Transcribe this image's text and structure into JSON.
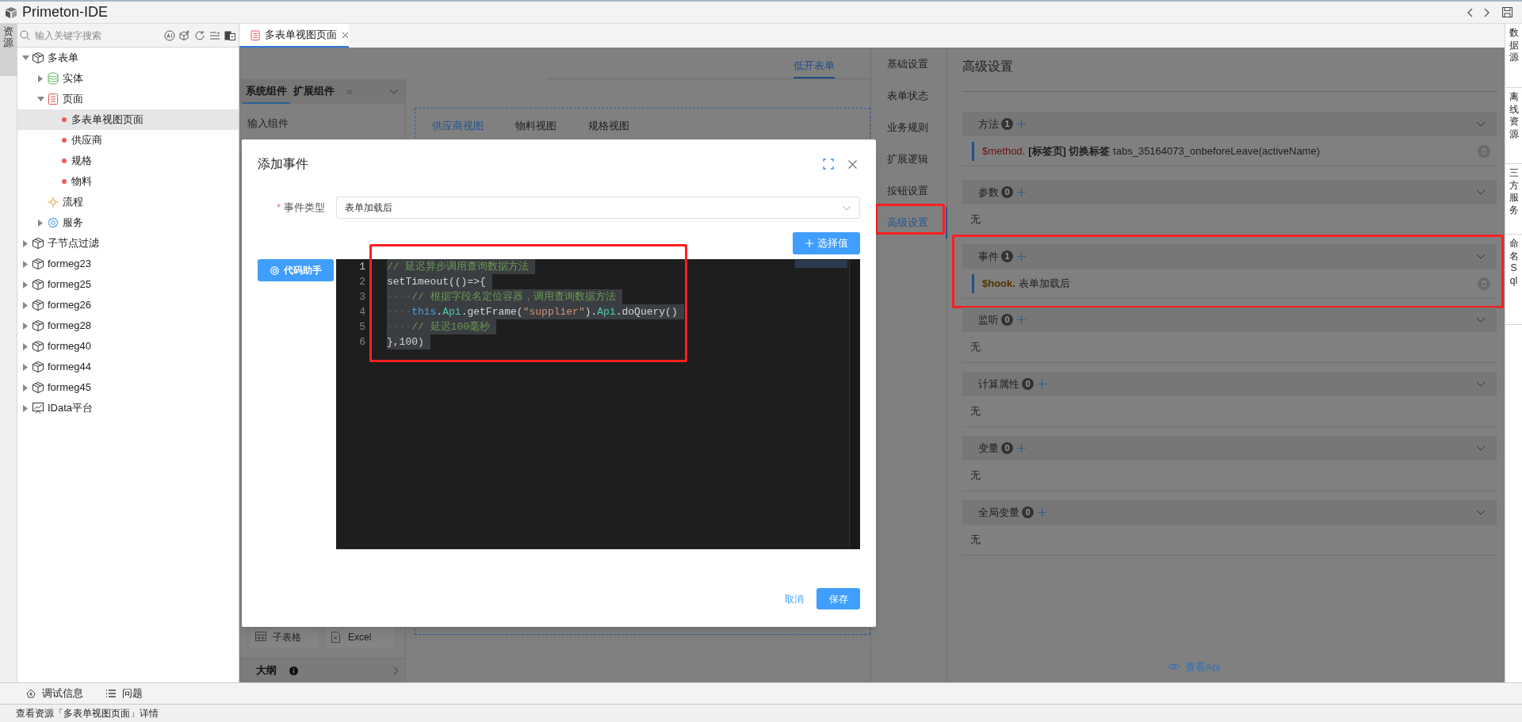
{
  "app": {
    "title": "Primeton-IDE"
  },
  "left_strip": [
    {
      "label": "资源",
      "selected": true
    }
  ],
  "sidebar": {
    "search": {
      "placeholder": "输入关键字搜索"
    },
    "tree": [
      {
        "label": "多表单",
        "kind": "module",
        "expanded": true,
        "selected": false,
        "children": [
          {
            "label": "实体",
            "kind": "entity",
            "expanded": false,
            "selected": false
          },
          {
            "label": "页面",
            "kind": "page",
            "expanded": true,
            "selected": false,
            "children": [
              {
                "label": "多表单视图页面",
                "kind": "view",
                "selected": true
              },
              {
                "label": "供应商",
                "kind": "view",
                "selected": false
              },
              {
                "label": "规格",
                "kind": "view",
                "selected": false
              },
              {
                "label": "物料",
                "kind": "view",
                "selected": false
              }
            ]
          },
          {
            "label": "流程",
            "kind": "flow",
            "selected": false
          },
          {
            "label": "服务",
            "kind": "service",
            "expanded": false,
            "selected": false
          }
        ]
      },
      {
        "label": "子节点过滤",
        "kind": "module",
        "expanded": false,
        "selected": false
      },
      {
        "label": "formeg23",
        "kind": "module",
        "expanded": false,
        "selected": false
      },
      {
        "label": "formeg25",
        "kind": "module",
        "expanded": false,
        "selected": false
      },
      {
        "label": "formeg26",
        "kind": "module",
        "expanded": false,
        "selected": false
      },
      {
        "label": "formeg28",
        "kind": "module",
        "expanded": false,
        "selected": false
      },
      {
        "label": "formeg40",
        "kind": "module",
        "expanded": false,
        "selected": false
      },
      {
        "label": "formeg44",
        "kind": "module",
        "expanded": false,
        "selected": false
      },
      {
        "label": "formeg45",
        "kind": "module",
        "expanded": false,
        "selected": false
      },
      {
        "label": "IData平台",
        "kind": "platform",
        "expanded": false,
        "selected": false
      }
    ]
  },
  "editor_tabs": [
    {
      "label": "多表单视图页面",
      "selected": true
    }
  ],
  "designer": {
    "mode_tabs": [
      {
        "label": "低开表单",
        "selected": true
      }
    ],
    "palette": {
      "tabs": [
        {
          "label": "系统组件",
          "selected": true
        },
        {
          "label": "扩展组件",
          "selected": false
        }
      ],
      "group": "输入组件",
      "components": [
        {
          "label": "子表格",
          "kind": "table"
        },
        {
          "label": "Excel",
          "kind": "file"
        }
      ],
      "outline": "大纲"
    },
    "canvas_tabs": [
      {
        "label": "供应商视图",
        "selected": true
      },
      {
        "label": "物料视图",
        "selected": false
      },
      {
        "label": "规格视图",
        "selected": false
      }
    ]
  },
  "settings": {
    "nav": [
      {
        "label": "基础设置",
        "selected": false,
        "highlighted": false
      },
      {
        "label": "表单状态",
        "selected": false,
        "highlighted": false
      },
      {
        "label": "业务规则",
        "selected": false,
        "highlighted": false
      },
      {
        "label": "扩展逻辑",
        "selected": false,
        "highlighted": false
      },
      {
        "label": "按钮设置",
        "selected": false,
        "highlighted": false
      },
      {
        "label": "高级设置",
        "selected": true,
        "highlighted": true
      }
    ],
    "title": "高级设置",
    "sections": [
      {
        "title": "方法",
        "count": "1",
        "highlighted": false,
        "items": [
          {
            "kind": "method",
            "prefix": "$method.",
            "text": "**[标签页] 切换标签** tabs_35164073_onbeforeLeave(activeName)"
          }
        ]
      },
      {
        "title": "参数",
        "count": "0",
        "highlighted": false,
        "empty_text": "无"
      },
      {
        "title": "事件",
        "count": "1",
        "highlighted": true,
        "items": [
          {
            "kind": "hook",
            "prefix": "$hook.",
            "text": "表单加载后"
          }
        ]
      },
      {
        "title": "监听",
        "count": "0",
        "highlighted": false,
        "empty_text": "无"
      },
      {
        "title": "计算属性",
        "count": "0",
        "highlighted": false,
        "empty_text": "无"
      },
      {
        "title": "变量",
        "count": "0",
        "highlighted": false,
        "empty_text": "无"
      },
      {
        "title": "全局变量",
        "count": "0",
        "highlighted": false,
        "empty_text": "无"
      }
    ],
    "api_link": "查看Api"
  },
  "right_strip": [
    "数据源",
    "离线资源",
    "三方服务",
    "命名Sql"
  ],
  "dialog": {
    "title": "添加事件",
    "event_type": {
      "required_mark": "*",
      "label": "事件类型",
      "value": "表单加载后"
    },
    "select_button": "选择值",
    "helper_button": "代码助手",
    "code": {
      "highlighted": true,
      "lines": [
        {
          "number": "1",
          "tokens": [
            {
              "kind": "comment",
              "text": "// 延迟异步调用查询数据方法"
            }
          ]
        },
        {
          "number": "2",
          "tokens": [
            {
              "kind": "plain",
              "text": "setTimeout(()=>{"
            }
          ]
        },
        {
          "number": "3",
          "tokens": [
            {
              "kind": "indent",
              "text": "····"
            },
            {
              "kind": "comment",
              "text": "// 根据字段名定位容器，调用查询数据方法"
            }
          ]
        },
        {
          "number": "4",
          "tokens": [
            {
              "kind": "indent",
              "text": "····"
            },
            {
              "kind": "keyword",
              "text": "this"
            },
            {
              "kind": "plain",
              "text": "."
            },
            {
              "kind": "type",
              "text": "Api"
            },
            {
              "kind": "plain",
              "text": ".getFrame("
            },
            {
              "kind": "string",
              "text": "\"supplier\""
            },
            {
              "kind": "plain",
              "text": ")."
            },
            {
              "kind": "type",
              "text": "Api"
            },
            {
              "kind": "plain",
              "text": ".doQuery()"
            }
          ]
        },
        {
          "number": "5",
          "tokens": [
            {
              "kind": "indent",
              "text": "····"
            },
            {
              "kind": "comment",
              "text": "// 延迟100毫秒"
            }
          ]
        },
        {
          "number": "6",
          "tokens": [
            {
              "kind": "plain",
              "text": "},100)"
            }
          ]
        }
      ]
    },
    "cancel_button": "取消",
    "save_button": "保存"
  },
  "bottom_tabs": [
    {
      "label": "调试信息",
      "kind": "debug"
    },
    {
      "label": "问题",
      "kind": "problems"
    }
  ],
  "status_bar": "查看资源「多表单视图页面」详情"
}
